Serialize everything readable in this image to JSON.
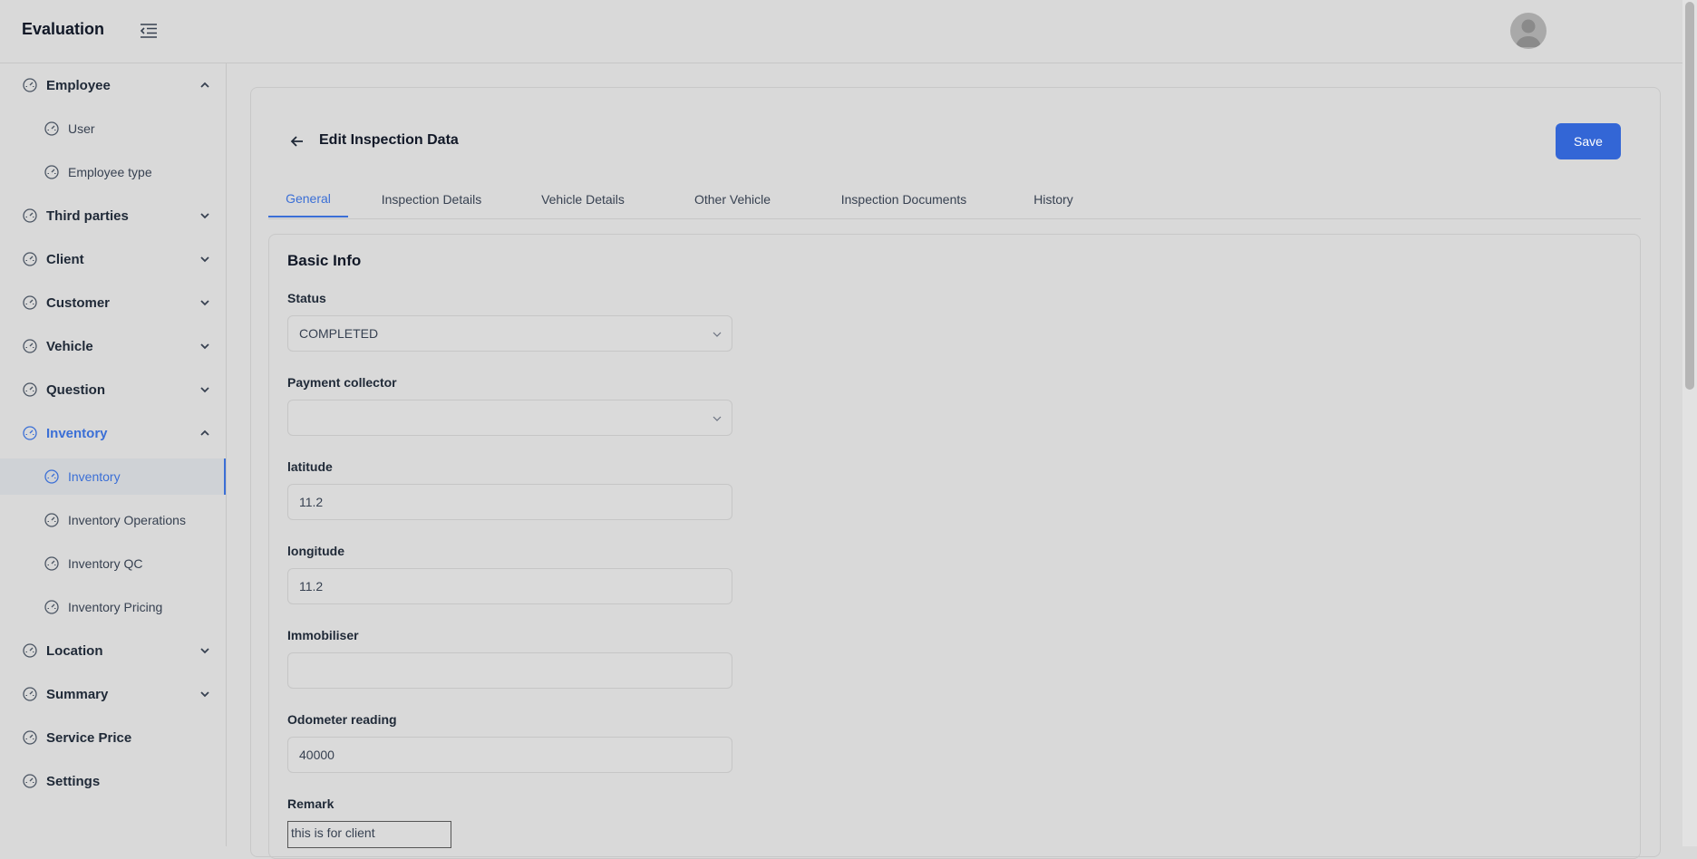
{
  "app": {
    "title": "Evaluation"
  },
  "sidebar": {
    "items": [
      {
        "label": "Employee",
        "level": "parent",
        "expanded": true
      },
      {
        "label": "User",
        "level": "child"
      },
      {
        "label": "Employee type",
        "level": "child"
      },
      {
        "label": "Third parties",
        "level": "parent",
        "expanded": false
      },
      {
        "label": "Client",
        "level": "parent",
        "expanded": false
      },
      {
        "label": "Customer",
        "level": "parent",
        "expanded": false
      },
      {
        "label": "Vehicle",
        "level": "parent",
        "expanded": false
      },
      {
        "label": "Question",
        "level": "parent",
        "expanded": false
      },
      {
        "label": "Inventory",
        "level": "parent",
        "expanded": true,
        "active": true
      },
      {
        "label": "Inventory",
        "level": "child",
        "active": true
      },
      {
        "label": "Inventory Operations",
        "level": "child"
      },
      {
        "label": "Inventory QC",
        "level": "child"
      },
      {
        "label": "Inventory Pricing",
        "level": "child"
      },
      {
        "label": "Location",
        "level": "parent",
        "expanded": false
      },
      {
        "label": "Summary",
        "level": "parent",
        "expanded": false
      },
      {
        "label": "Service Price",
        "level": "parent"
      },
      {
        "label": "Settings",
        "level": "parent"
      }
    ]
  },
  "page": {
    "title": "Edit Inspection Data",
    "save_label": "Save",
    "tabs": [
      {
        "label": "General",
        "active": true
      },
      {
        "label": "Inspection Details"
      },
      {
        "label": "Vehicle Details"
      },
      {
        "label": "Other Vehicle"
      },
      {
        "label": "Inspection Documents"
      },
      {
        "label": "History"
      }
    ]
  },
  "form": {
    "section_title": "Basic Info",
    "status": {
      "label": "Status",
      "value": "COMPLETED"
    },
    "payment_collector": {
      "label": "Payment collector",
      "value": ""
    },
    "latitude": {
      "label": "latitude",
      "value": "11.2"
    },
    "longitude": {
      "label": "longitude",
      "value": "11.2"
    },
    "immobiliser": {
      "label": "Immobiliser",
      "value": ""
    },
    "odometer": {
      "label": "Odometer reading",
      "value": "40000"
    },
    "remark": {
      "label": "Remark",
      "value": "this is for client"
    }
  },
  "colors": {
    "accent": "#3366d6",
    "background": "#d9d9d9"
  }
}
